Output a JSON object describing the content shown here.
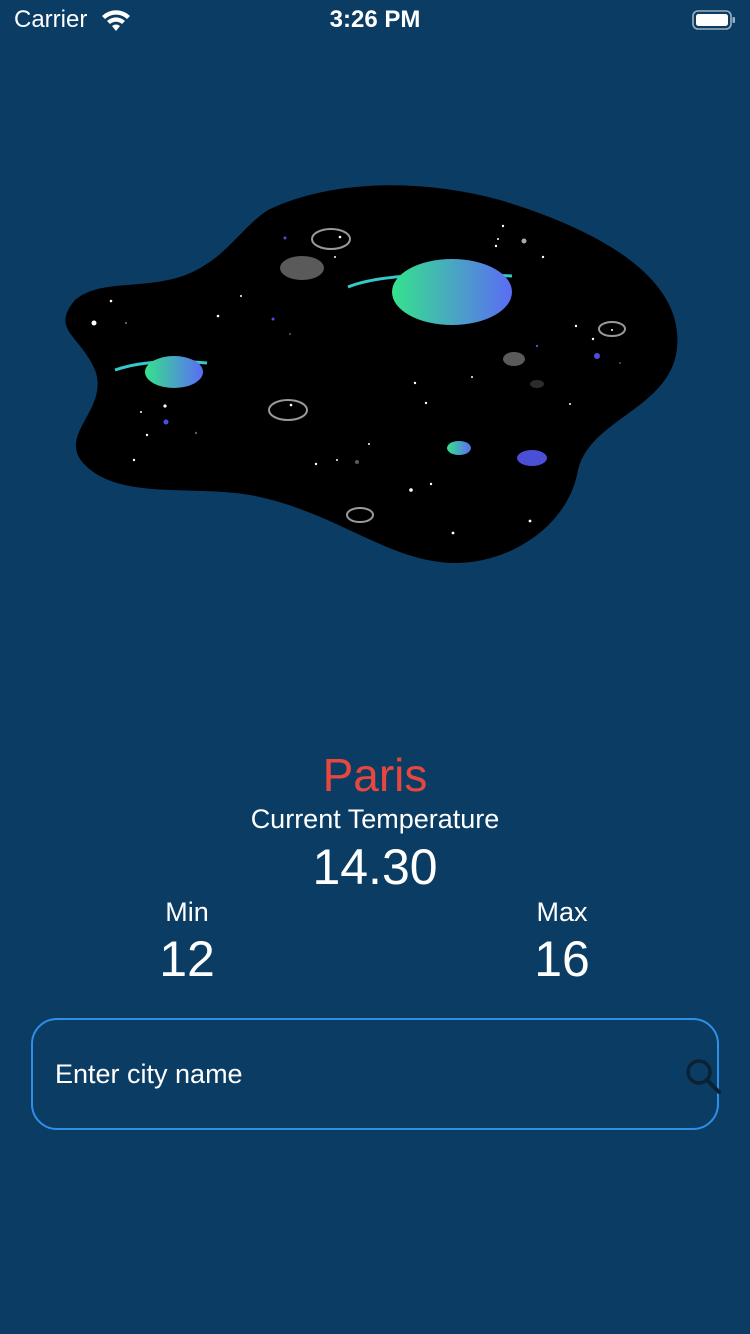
{
  "status_bar": {
    "carrier": "Carrier",
    "time": "3:26 PM"
  },
  "illustration": {
    "icon": "space-planets-illustration"
  },
  "weather": {
    "city": "Paris",
    "current_label": "Current Temperature",
    "current_value": "14.30",
    "min_label": "Min",
    "min_value": "12",
    "max_label": "Max",
    "max_value": "16"
  },
  "search": {
    "placeholder": "Enter city name",
    "value": "",
    "icon": "search-icon"
  },
  "colors": {
    "background": "#0b3c63",
    "city_text": "#e8473f",
    "input_border": "#2f8fe6"
  }
}
